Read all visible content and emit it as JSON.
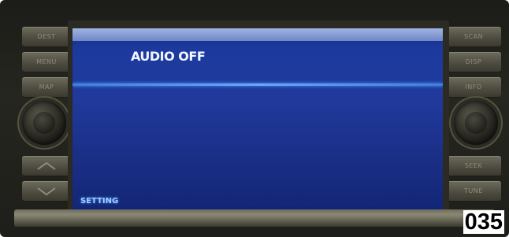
{
  "left_buttons": [
    {
      "label": "DEST"
    },
    {
      "label": "MENU"
    },
    {
      "label": "MAP"
    }
  ],
  "right_buttons": [
    {
      "label": "SCAN"
    },
    {
      "label": "DISP"
    },
    {
      "label": "INFO"
    },
    {
      "label": "SEEK"
    },
    {
      "label": "TUNE"
    }
  ],
  "screen": {
    "title": "AUDIO OFF",
    "setting_label": "SETTING"
  },
  "figure_number": "035",
  "colors": {
    "screen_blue": "#1c3a9e",
    "divider_blue": "#69a8ff",
    "bezel": "#2b2a23"
  },
  "icons": {
    "left_knob": "volume-knob",
    "right_knob": "tune-knob",
    "up_arrow": "chevron-up-icon",
    "down_arrow": "chevron-down-icon"
  }
}
